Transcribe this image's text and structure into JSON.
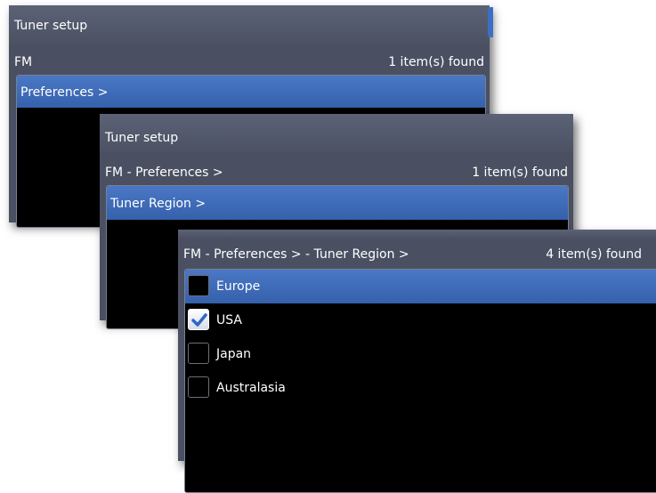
{
  "windows": [
    {
      "title": "Tuner setup",
      "path": "FM",
      "count": "1 item(s) found",
      "selected_item": "Preferences >"
    },
    {
      "title": "Tuner setup",
      "path": "FM - Preferences >",
      "count": "1 item(s) found",
      "selected_item": "Tuner Region >"
    },
    {
      "path": "FM - Preferences > - Tuner Region >",
      "count": "4 item(s) found",
      "options": [
        {
          "label": "Europe",
          "checked": false,
          "highlighted": true
        },
        {
          "label": "USA",
          "checked": true,
          "highlighted": false
        },
        {
          "label": "Japan",
          "checked": false,
          "highlighted": false
        },
        {
          "label": "Australasia",
          "checked": false,
          "highlighted": false
        }
      ]
    }
  ],
  "colors": {
    "dialog_bg": "#4a5062",
    "selection": "#3d6cba",
    "list_bg": "#000000",
    "check_mark": "#2f66c8"
  },
  "icons": {
    "checked": "checkmark-icon"
  }
}
